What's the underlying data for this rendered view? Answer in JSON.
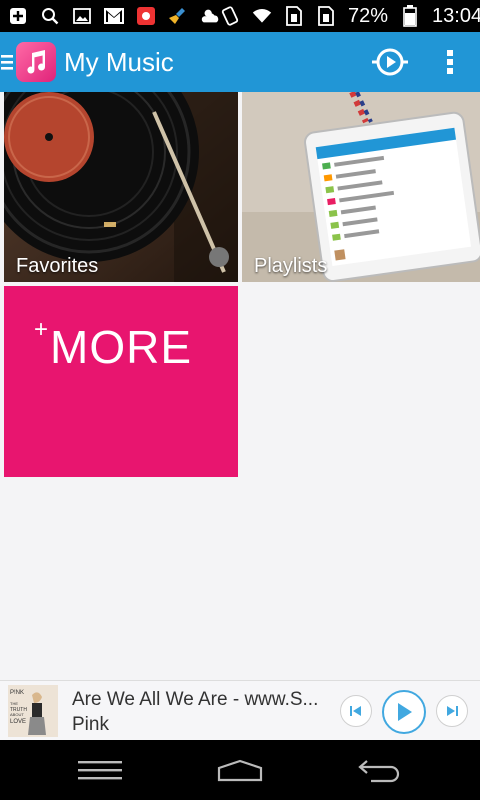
{
  "status_bar": {
    "battery": "72%",
    "time": "13:04",
    "left_icons": [
      "add-icon",
      "search-icon",
      "image-icon",
      "gmail-icon",
      "photo-icon",
      "broom-icon",
      "weather-icon"
    ],
    "right_icons": [
      "rotate-icon",
      "wifi-icon",
      "sim-icon",
      "sim-icon",
      "battery-icon"
    ]
  },
  "app_bar": {
    "title": "My Music",
    "accent": "#2196d6"
  },
  "tiles": {
    "favorites": "Favorites",
    "playlists": "Playlists",
    "more_plus": "+",
    "more": "MORE",
    "more_color": "#e8156f"
  },
  "now_playing": {
    "title": "Are We All We Are - www.S...",
    "artist": "Pink",
    "album_art_text": [
      "P!NK",
      "THE",
      "TRUTH",
      "ABOUT",
      "LOVE"
    ]
  }
}
